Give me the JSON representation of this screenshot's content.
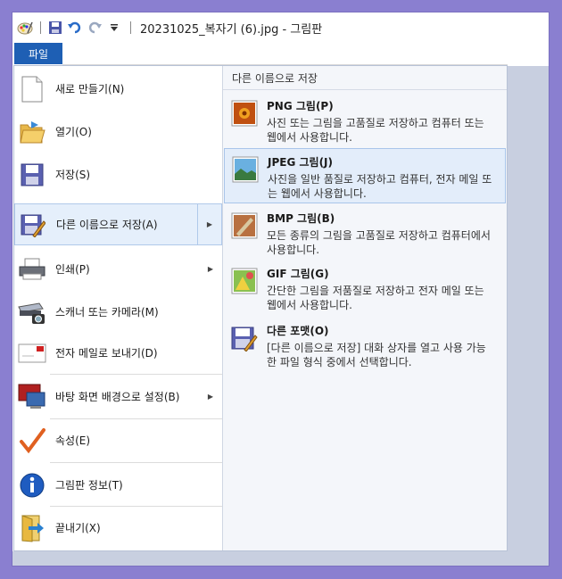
{
  "titlebar": {
    "title": "20231025_복자기 (6).jpg - 그림판"
  },
  "file_tab": {
    "label": "파일"
  },
  "menu": {
    "items": [
      {
        "label": "새로 만들기(N)",
        "icon": "new-file-icon",
        "submenu": false
      },
      {
        "label": "열기(O)",
        "icon": "open-folder-icon",
        "submenu": false
      },
      {
        "label": "저장(S)",
        "icon": "save-icon",
        "submenu": false
      },
      {
        "label": "다른 이름으로 저장(A)",
        "icon": "save-as-icon",
        "submenu": true,
        "selected": true
      },
      {
        "label": "인쇄(P)",
        "icon": "printer-icon",
        "submenu": true
      },
      {
        "label": "스캐너 또는 카메라(M)",
        "icon": "scanner-camera-icon",
        "submenu": false
      },
      {
        "label": "전자 메일로 보내기(D)",
        "icon": "email-icon",
        "submenu": false
      },
      {
        "label": "바탕 화면 배경으로 설정(B)",
        "icon": "desktop-background-icon",
        "submenu": true
      },
      {
        "label": "속성(E)",
        "icon": "checkmark-icon",
        "submenu": false
      },
      {
        "label": "그림판 정보(T)",
        "icon": "info-icon",
        "submenu": false
      },
      {
        "label": "끝내기(X)",
        "icon": "exit-icon",
        "submenu": false
      }
    ]
  },
  "save_as_panel": {
    "header": "다른 이름으로 저장",
    "options": [
      {
        "name": "PNG 그림(P)",
        "desc": "사진 또는 그림을 고품질로 저장하고 컴퓨터 또는 웹에서 사용합니다.",
        "icon": "png-image-icon"
      },
      {
        "name": "JPEG 그림(J)",
        "desc": "사진을 일반 품질로 저장하고 컴퓨터, 전자 메일 또는 웹에서 사용합니다.",
        "icon": "jpeg-image-icon",
        "selected": true
      },
      {
        "name": "BMP 그림(B)",
        "desc": "모든 종류의 그림을 고품질로 저장하고 컴퓨터에서 사용합니다.",
        "icon": "bmp-image-icon"
      },
      {
        "name": "GIF 그림(G)",
        "desc": "간단한 그림을 저품질로 저장하고 전자 메일 또는 웹에서 사용합니다.",
        "icon": "gif-image-icon"
      },
      {
        "name": "다른 포맷(O)",
        "desc": "[다른 이름으로 저장] 대화 상자를 열고 사용 가능한 파일 형식 중에서 선택합니다.",
        "icon": "other-format-icon"
      }
    ]
  },
  "colors": {
    "accent": "#1e5fb4",
    "selected_bg": "#e5effb",
    "selected_border": "#b0c9ea"
  }
}
